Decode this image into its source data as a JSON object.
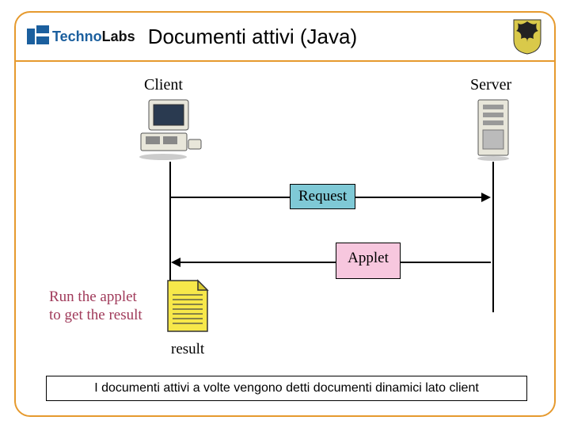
{
  "header": {
    "logo_brand": "Techno",
    "logo_suffix": "Labs",
    "title": "Documenti attivi (Java)"
  },
  "diagram": {
    "client_label": "Client",
    "server_label": "Server",
    "request_label": "Request",
    "applet_label": "Applet",
    "run_line1": "Run the applet",
    "run_line2": "to get the result",
    "result_label": "result"
  },
  "footer": {
    "text": "I documenti attivi a volte vengono detti documenti dinamici lato client"
  }
}
